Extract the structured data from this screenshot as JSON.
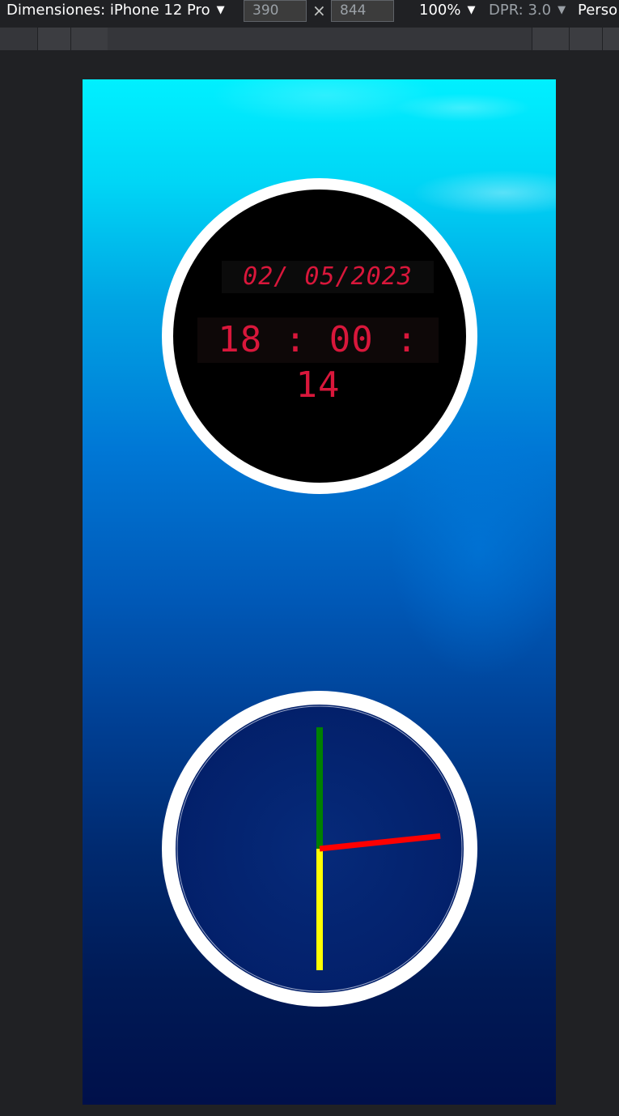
{
  "devtools": {
    "device_label": "Dimensiones: iPhone 12 Pro",
    "width": "390",
    "height": "844",
    "times": "×",
    "zoom": "100%",
    "dpr": "DPR: 3.0",
    "more": "Perso"
  },
  "digital_clock": {
    "date": "02/ 05/2023",
    "time": "18 : 00 : 14",
    "text_color": "#d9173b"
  },
  "analog_clock": {
    "hour": 18,
    "minute": 0,
    "second": 14,
    "colors": {
      "hour_hand": "#ffff00",
      "minute_hand": "#008000",
      "second_hand": "#ff0000"
    }
  }
}
